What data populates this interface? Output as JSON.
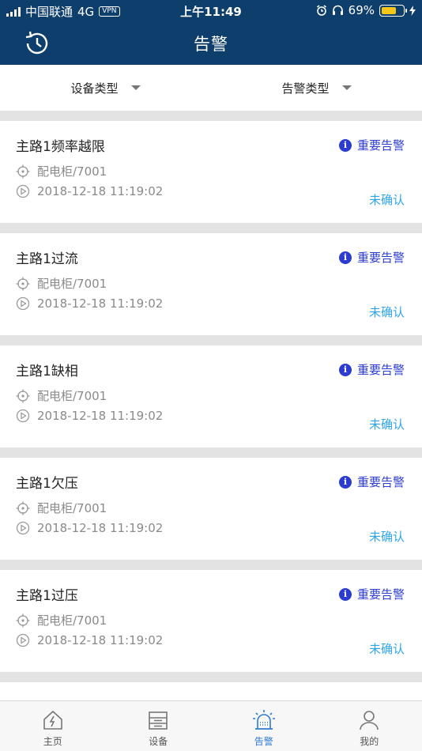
{
  "status_bar": {
    "carrier": "中国联通",
    "network": "4G",
    "vpn": "VPN",
    "time": "上午11:49",
    "battery": "69%"
  },
  "header": {
    "title": "告警",
    "history_icon": "history-icon"
  },
  "filters": [
    {
      "label": "设备类型"
    },
    {
      "label": "告警类型"
    }
  ],
  "alarms": [
    {
      "title": "主路1频率越限",
      "level": "重要告警",
      "location": "配电柜/7001",
      "time": "2018-12-18 11:19:02",
      "state": "未确认"
    },
    {
      "title": "主路1过流",
      "level": "重要告警",
      "location": "配电柜/7001",
      "time": "2018-12-18 11:19:02",
      "state": "未确认"
    },
    {
      "title": "主路1缺相",
      "level": "重要告警",
      "location": "配电柜/7001",
      "time": "2018-12-18 11:19:02",
      "state": "未确认"
    },
    {
      "title": "主路1欠压",
      "level": "重要告警",
      "location": "配电柜/7001",
      "time": "2018-12-18 11:19:02",
      "state": "未确认"
    },
    {
      "title": "主路1过压",
      "level": "重要告警",
      "location": "配电柜/7001",
      "time": "2018-12-18 11:19:02",
      "state": "未确认"
    }
  ],
  "tabs": [
    {
      "label": "主页",
      "icon": "home-icon"
    },
    {
      "label": "设备",
      "icon": "device-icon"
    },
    {
      "label": "告警",
      "icon": "alarm-icon"
    },
    {
      "label": "我的",
      "icon": "user-icon"
    }
  ],
  "colors": {
    "header_bg": "#0e3e6c",
    "level_text": "#2c3bd0",
    "state_text": "#2fa4e8",
    "active_tab": "#2f7ad1"
  }
}
